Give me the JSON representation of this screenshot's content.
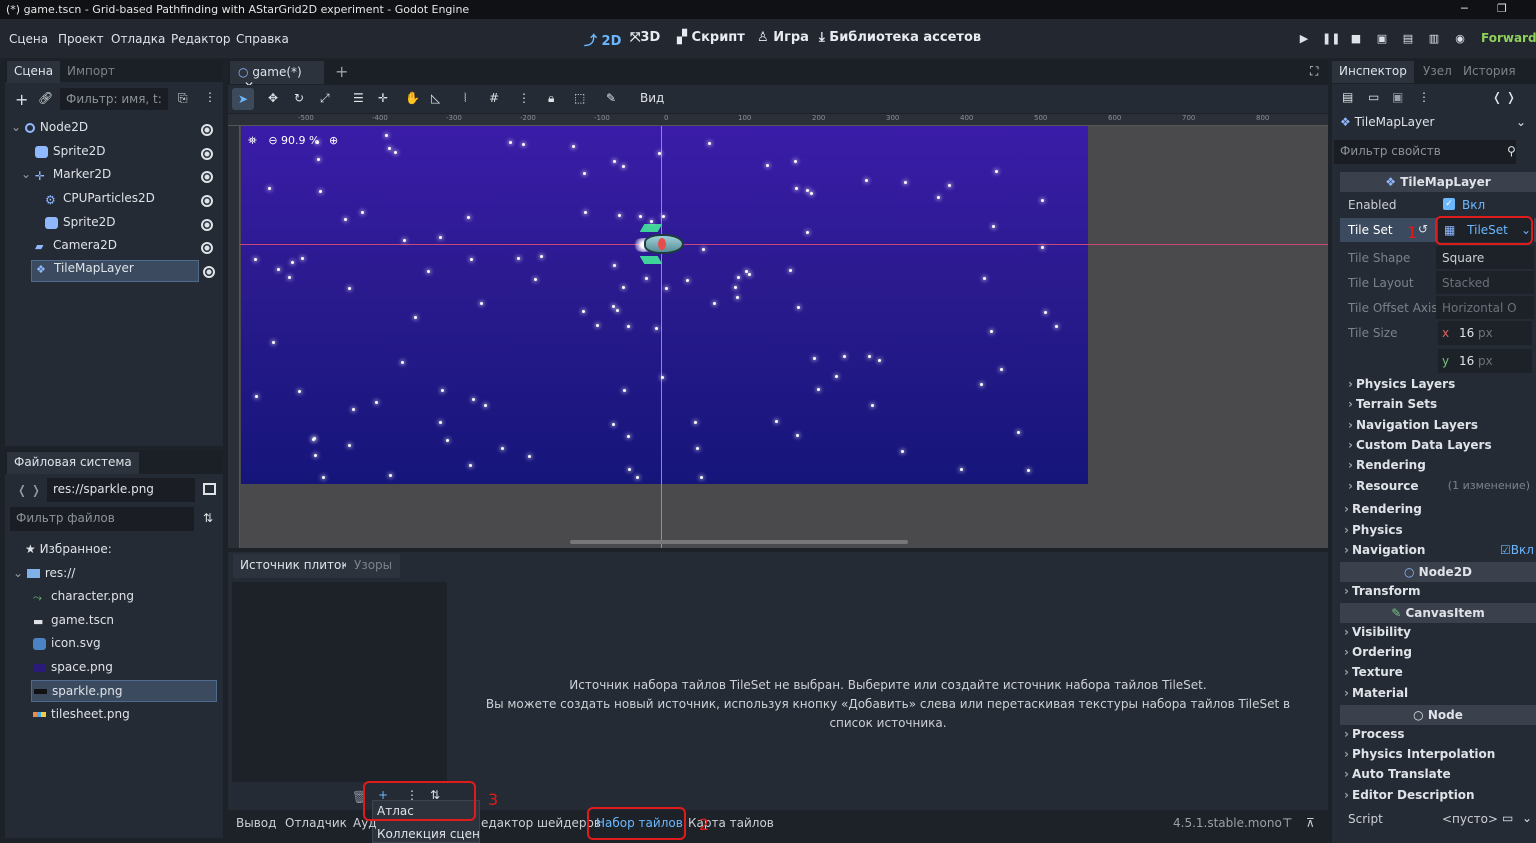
{
  "window_title": "(*) game.tscn - Grid-based Pathfinding with AStarGrid2D experiment - Godot Engine",
  "menu": [
    "Сцена",
    "Проект",
    "Отладка",
    "Редактор",
    "Справка"
  ],
  "workspaces": [
    "2D",
    "3D",
    "Скрипт",
    "Игра",
    "Библиотека ассетов"
  ],
  "renderer": "Forward+",
  "scene_dock": {
    "tabs": [
      "Сцена",
      "Импорт"
    ],
    "filter_placeholder": "Фильтр: имя, t:",
    "tree": [
      "Node2D",
      "Sprite2D",
      "Marker2D",
      "CPUParticles2D",
      "Sprite2D",
      "Camera2D",
      "TileMapLayer"
    ]
  },
  "filesystem": {
    "title": "Файловая система",
    "path": "res://sparkle.png",
    "filter_placeholder": "Фильтр файлов",
    "items": [
      "Избранное:",
      "res://",
      "character.png",
      "game.tscn",
      "icon.svg",
      "space.png",
      "sparkle.png",
      "tilesheet.png"
    ]
  },
  "editor": {
    "tab": "game(*)",
    "view_label": "Вид",
    "zoom": "90.9 %",
    "ruler": [
      "-500",
      "-400",
      "-300",
      "-200",
      "-100",
      "0",
      "100",
      "200",
      "300",
      "400",
      "500",
      "600",
      "700",
      "800"
    ]
  },
  "bottom": {
    "tabs": [
      "Источник плиток",
      "Узоры"
    ],
    "message_1": "Источник набора тайлов TileSet не выбран. Выберите или создайте источник набора тайлов TileSet.",
    "message_2": "Вы можете создать новый источник, используя кнопку «Добавить» слева или перетаскивая текстуры набора тайлов TileSet в список источника.",
    "dropdown": [
      "Атлас",
      "Коллекция сцен"
    ],
    "panel_tabs": [
      "Вывод",
      "Отладчик",
      "Ауд",
      "едактор шейдеров",
      "Набор тайлов",
      "Карта тайлов"
    ],
    "version": "4.5.1.stable.mono"
  },
  "inspector": {
    "tabs": [
      "Инспектор",
      "Узел",
      "История"
    ],
    "node": "TileMapLayer",
    "filter_placeholder": "Фильтр свойств",
    "header": "TileMapLayer",
    "enabled_label": "Enabled",
    "enabled_val": "Вкл",
    "tileset_label": "Tile Set",
    "tileset_val": "TileSet",
    "tile_shape_label": "Tile Shape",
    "tile_shape_val": "Square",
    "tile_layout_label": "Tile Layout",
    "tile_layout_val": "Stacked",
    "tile_offset_label": "Tile Offset Axis",
    "tile_offset_val": "Horizontal O",
    "tile_size_label": "Tile Size",
    "tile_size_x": "16",
    "tile_size_y": "16",
    "px": "px",
    "x": "x",
    "y": "y",
    "sub_sections": [
      "Physics Layers",
      "Terrain Sets",
      "Navigation Layers",
      "Custom Data Layers",
      "Rendering",
      "Resource"
    ],
    "resource_note": "(1 изменение)",
    "sections_a": [
      "Rendering",
      "Physics",
      "Navigation"
    ],
    "nav_enabled": "Вкл",
    "node2d": "Node2D",
    "sections_b": [
      "Transform"
    ],
    "canvasitem": "CanvasItem",
    "sections_c": [
      "Visibility",
      "Ordering",
      "Texture",
      "Material"
    ],
    "node_cat": "Node",
    "sections_d": [
      "Process",
      "Physics Interpolation",
      "Auto Translate",
      "Editor Description"
    ],
    "script_label": "Script",
    "script_val": "<пусто>"
  },
  "annotations": [
    "1",
    "2",
    "3"
  ]
}
